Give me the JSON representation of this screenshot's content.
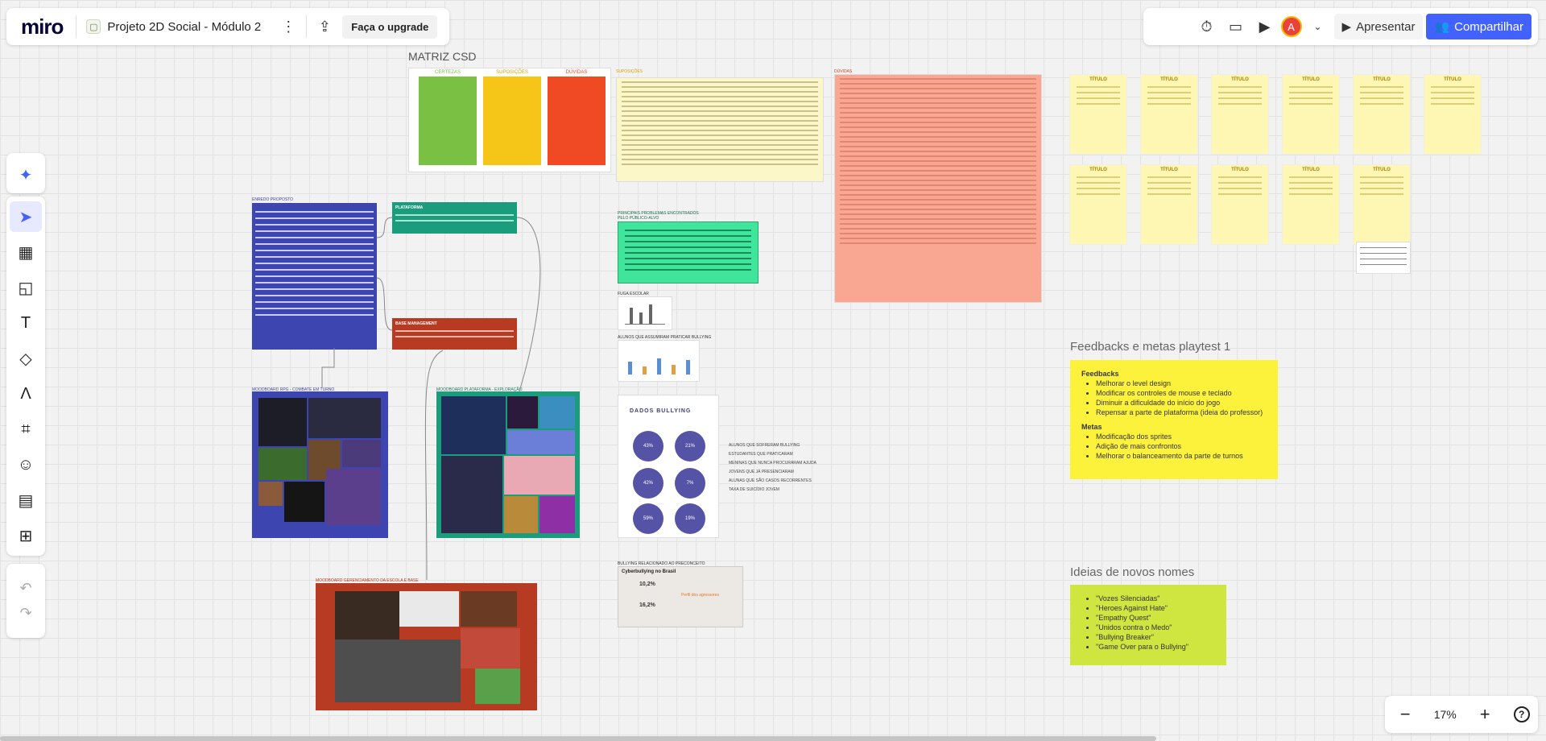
{
  "app": {
    "logo": "miro",
    "board_title": "Projeto 2D Social - Módulo 2",
    "upgrade_label": "Faça o upgrade",
    "present_label": "Apresentar",
    "share_label": "Compartilhar",
    "avatar_initial": "A",
    "zoom_level": "17%",
    "zoom_minus": "−",
    "zoom_plus": "+",
    "help": "?"
  },
  "colors": {
    "accent": "#4262ff",
    "green_col": "#7ac143",
    "yellow_col": "#f5c518",
    "red_col": "#ef4a24",
    "blue_note": "#3d45b0",
    "teal_note": "#1a9c7d",
    "red_note": "#b73a22"
  },
  "board": {
    "csd_title": "MATRIZ CSD",
    "csd_headers": [
      "CERTEZAS",
      "SUPOSIÇÕES",
      "DÚVIDAS"
    ],
    "suposicoes_label": "SUPOSIÇÕES",
    "duvidas_label": "DÚVIDAS",
    "enredo_label": "ENREDO PROPOSTO",
    "plataforma_label": "PLATAFORMA",
    "base_label": "BASE MANAGEMENT",
    "problemas_label": "PRINCIPAIS PROBLEMAS ENCONTRADOS PELO PÚBLICO-ALVO",
    "fuga_label": "FUGA ESCOLAR",
    "alunos_label": "ALUNOS QUE ASSUMIRAM PRATICAR BULLYING",
    "rpg_label": "MOODBOARD RPG - COMBATE EM TURNO",
    "plat_mood_label": "MOODBOARD PLATAFORMA - EXPLORAÇÃO",
    "base_mood_label": "MOODBOARD GERENCIAMENTO DA ESCOLA E BASE",
    "bullying_title": "DADOS BULLYING",
    "bullying_stats": [
      "43%",
      "21%",
      "42%",
      "7%",
      "59%",
      "19%"
    ],
    "bullying_legend": [
      "ALUNOS QUE SOFRERAM BULLYING",
      "ESTUDANTES QUE PRATICARAM",
      "MENINAS QUE NUNCA PROCURARAM AJUDA",
      "JOVENS QUE JÁ PRESENCIARAM",
      "ALUNAS QUE SÃO CASOS RECORRENTES",
      "TAXA DE SUICÍDIO JOVEM"
    ],
    "cyber_label": "BULLYING RELACIONADO AO PRECONCEITO",
    "cyber_title": "Cyberbullying no Brasil",
    "cyber_stats": [
      "10,2%",
      "16,2%"
    ],
    "cyber_sub": "Perfil dos agressores",
    "card_title": "TÍTULO",
    "feedback_section_title": "Feedbacks e metas playtest 1",
    "feedbacks_heading": "Feedbacks",
    "feedbacks": [
      "Melhorar o level design",
      "Modificar os controles de mouse e teclado",
      "Diminuir a dificuldade do início do jogo",
      "Repensar a parte de plataforma (ideia do professor)"
    ],
    "metas_heading": "Metas",
    "metas": [
      "Modificação dos sprites",
      "Adição de mais confrontos",
      "Melhorar o balanceamento da parte de turnos"
    ],
    "names_section_title": "Ideias de novos nomes",
    "names": [
      "\"Vozes Silenciadas\"",
      "\"Heroes Against Hate\"",
      "\"Empathy Quest\"",
      "\"Unidos contra o Medo\"",
      "\"Bullying Breaker\"",
      "\"Game Over para o Bullying\""
    ]
  }
}
